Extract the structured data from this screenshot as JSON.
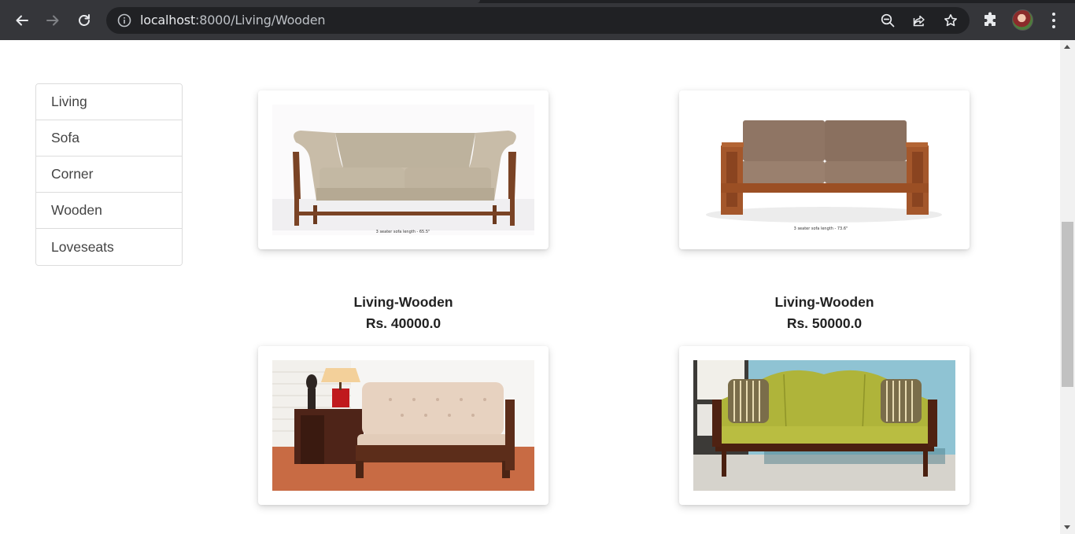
{
  "browser": {
    "url_host": "localhost",
    "url_path": ":8000/Living/Wooden"
  },
  "sidebar": {
    "items": [
      {
        "label": "Living"
      },
      {
        "label": "Sofa"
      },
      {
        "label": "Corner"
      },
      {
        "label": "Wooden"
      },
      {
        "label": "Loveseats"
      }
    ]
  },
  "products": [
    {
      "title": "Living-Wooden",
      "price": "Rs. 40000.0",
      "caption": "3 seater sofa length - 65.5\""
    },
    {
      "title": "Living-Wooden",
      "price": "Rs. 50000.0",
      "caption": "3 seater sofa length - 73.6\""
    },
    {
      "title": "",
      "price": ""
    },
    {
      "title": "",
      "price": ""
    }
  ],
  "colors": {
    "browser_chrome": "#35363a",
    "omnibox": "#202124",
    "text_dark": "#222222"
  }
}
